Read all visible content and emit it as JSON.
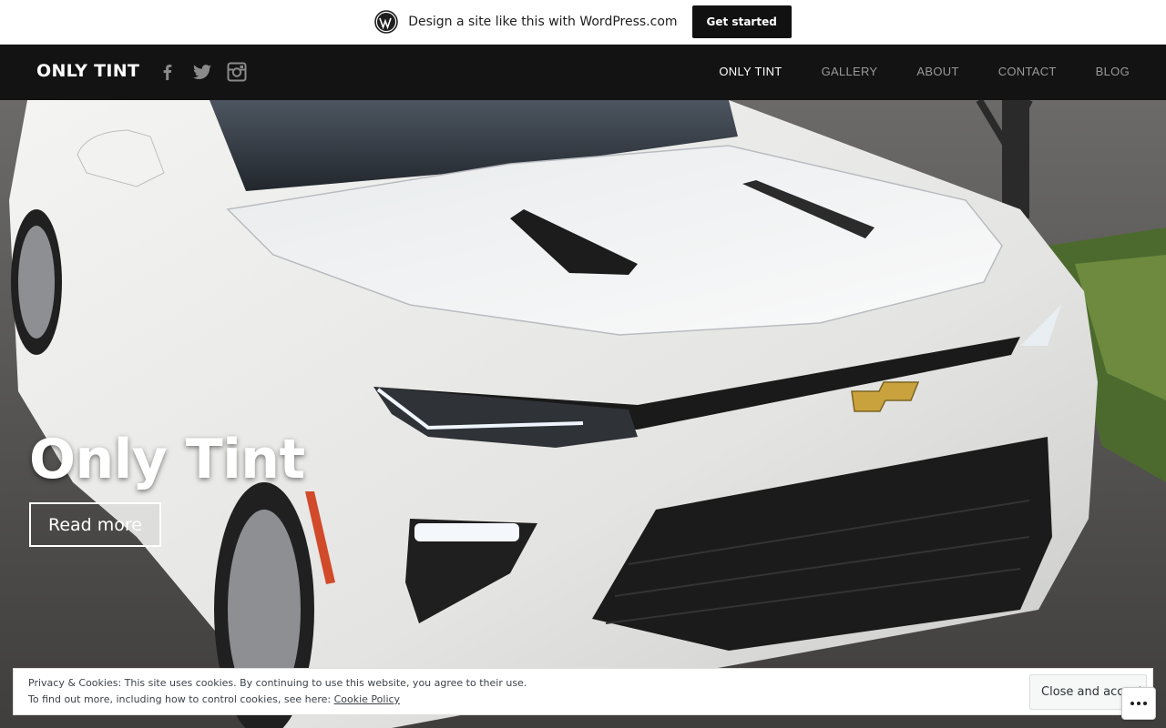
{
  "wp_bar": {
    "promo_text": "Design a site like this with WordPress.com",
    "cta_label": "Get started",
    "logo_icon": "wordpress-logo-icon"
  },
  "header": {
    "site_title": "ONLY TINT",
    "social_icons": [
      "facebook-icon",
      "twitter-icon",
      "instagram-icon"
    ],
    "nav": [
      {
        "label": "ONLY TINT",
        "active": true
      },
      {
        "label": "GALLERY",
        "active": false
      },
      {
        "label": "ABOUT",
        "active": false
      },
      {
        "label": "CONTACT",
        "active": false
      },
      {
        "label": "BLOG",
        "active": false
      }
    ]
  },
  "hero": {
    "title": "Only Tint",
    "button_label": "Read more",
    "image_subject": "white Chevrolet Camaro"
  },
  "cookie_banner": {
    "line1": "Privacy & Cookies: This site uses cookies. By continuing to use this website, you agree to their use.",
    "line2": "To find out more, including how to control cookies, see here: ",
    "policy_link": "Cookie Policy",
    "button_label": "Close and accept"
  },
  "more_button_icon": "ellipsis-icon",
  "colors": {
    "header_bg": "#131313",
    "nav_active": "#ffffff",
    "nav_inactive": "#9a9a9a",
    "wp_button_bg": "#111111"
  }
}
